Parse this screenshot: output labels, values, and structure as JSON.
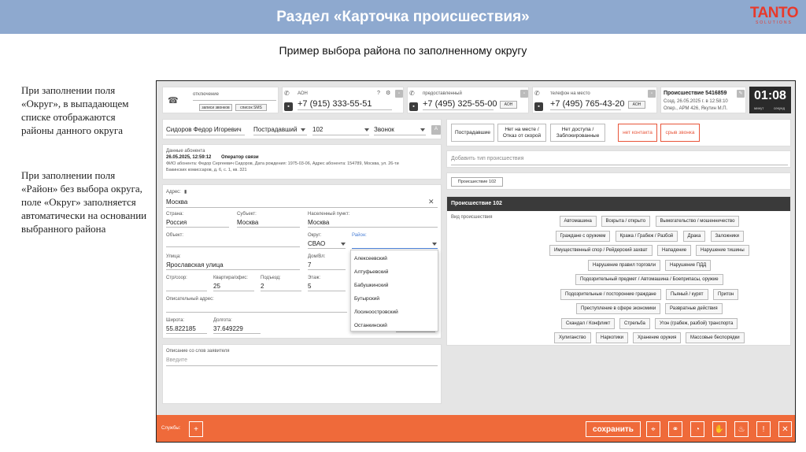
{
  "header": {
    "title": "Раздел «Карточка происшествия»",
    "logo": "TANTO",
    "logo_sub": "SOLUTIONS"
  },
  "subtitle": "Пример выбора района по заполненному округу",
  "notes": {
    "para1": "При заполнении поля «Округ», в выпадающем списке отображаются районы данного округа",
    "para2": "При заполнении поля «Район» без выбора округа, поле «Округ» заполняется автоматически на основании выбранного района"
  },
  "app": {
    "call": {
      "label": "отключение",
      "btn_records": "записи звонков",
      "btn_sms": "список SMS"
    },
    "phones": [
      {
        "label": "АОН",
        "number": "+7 (915) 333-55-51",
        "aon": ""
      },
      {
        "label": "предоставленный",
        "number": "+7 (495) 325-55-00",
        "aon": "АОН"
      },
      {
        "label": "телефон на место",
        "number": "+7 (495) 765-43-20",
        "aon": "АОН"
      }
    ],
    "incident": {
      "title": "Происшествие 5416859",
      "created": "Созд. 26.05.2025 г. в 12:58:10",
      "operator": "Опер., АРМ 426, Якутин М.П."
    },
    "timer": {
      "value": "01:08",
      "min_label": "минут",
      "sec_label": "секунд"
    },
    "person": {
      "name": "Сидоров Федор Игоревич",
      "role": "Пострадавший",
      "num": "102",
      "type": "Звонок"
    },
    "subscriber": {
      "title": "Данные абонента",
      "line1_date": "26.05.2025, 12:59:12",
      "line1_src": "Оператор связи",
      "line2": "ФИО абонента: Федор Сергеевич Сидоров, Дата рождения: 1975-03-06, Адрес абонента: 154789, Москва, ул. 26-ти",
      "line3": "Бакинских комиссаров, д. 6, с. 1, кв. 321"
    },
    "address": {
      "label": "Адрес:",
      "value": "Москва",
      "country_label": "Страна:",
      "country": "Россия",
      "subject_label": "Субъект:",
      "subject": "Москва",
      "city_label": "Населенный пункт:",
      "city": "Москва",
      "object_label": "Объект:",
      "okrug_label": "Округ:",
      "okrug": "СВАО",
      "rayon_label": "Район:",
      "street_label": "Улица:",
      "street": "Ярославская улица",
      "house_label": "Дом/Вл:",
      "house": "7",
      "building_label": "Стр/соор:",
      "flat_label": "Квартира/офис:",
      "flat": "25",
      "entrance_label": "Подъезд:",
      "entrance": "2",
      "floor_label": "Этаж:",
      "floor": "5",
      "desc_label": "Описательный адрес:",
      "lat_label": "Широта:",
      "lat": "55.822185",
      "lon_label": "Долгота:",
      "lon": "37.649229"
    },
    "districts": [
      "Алексеевский",
      "Алтуфьевский",
      "Бабушкинский",
      "Бутырский",
      "Лосиноостровский",
      "Останкинский"
    ],
    "statement": {
      "label": "Описание со слов заявителя",
      "placeholder": "Введите"
    },
    "top_buttons": {
      "victim": "Пострадавшие",
      "absent1": "Нет на месте /",
      "absent2": "Отказ от скорой",
      "noaccess1": "Нет доступа /",
      "noaccess2": "Заблокированные",
      "no_contact": "нет контакта",
      "dropped": "срыв звонка"
    },
    "add_type_placeholder": "Добавить тип происшествия",
    "incident_tab": "Происшествие 102",
    "panel_title": "Происшествие 102",
    "kind_label": "Вид происшествия",
    "tags": [
      [
        "Автомашина",
        "Вскрыта / открыто",
        "Вымогательство / мошенничество"
      ],
      [
        "Граждане с оружием",
        "Кража / Грабеж / Разбой",
        "Драка",
        "Заложники"
      ],
      [
        "Имущественный спор / Рейдерский захват",
        "Нападение",
        "Нарушение тишины"
      ],
      [
        "Нарушение правил торговли",
        "Нарушение ПДД"
      ],
      [
        "Подозрительный предмет / Автомашина / Боеприпасы, оружие"
      ],
      [
        "Подозрительные / посторонние граждане",
        "Пьяный / курят",
        "Притон"
      ],
      [
        "Преступление в сфере экономики",
        "Развратные действия"
      ],
      [
        "Скандал / Конфликт",
        "Стрельба",
        "Угон (грабеж, разбой) транспорта"
      ],
      [
        "Хулиганство",
        "Наркотики",
        "Хранение оружия",
        "Массовые беспорядки"
      ]
    ],
    "footer": {
      "services_label": "Службы:",
      "save": "сохранить"
    }
  }
}
